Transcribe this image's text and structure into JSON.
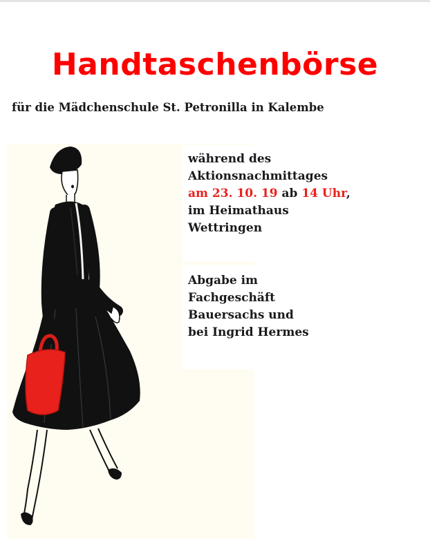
{
  "poster": {
    "title": "Handtaschenbörse",
    "subtitle": "für die Mädchenschule St.  Petronilla in Kalembe"
  },
  "event": {
    "line1": "während des",
    "line2": "Aktionsnachmittages",
    "date_prefix": "am 23. 10. 19",
    "date_middle": " ab ",
    "time": "14 Uhr",
    "date_suffix": ",",
    "line4": "im Heimathaus",
    "line5": "Wettringen"
  },
  "dropoff": {
    "line1": "Abgabe im",
    "line2": "Fachgeschäft",
    "line3": "Bauersachs und",
    "line4": "bei Ingrid Hermes"
  },
  "colors": {
    "accent_red": "#ff0000",
    "text_dark": "#1a1a1a",
    "handbag_red": "#e8211d"
  },
  "illustration": {
    "icon": "woman-with-red-handbag-illustration"
  }
}
